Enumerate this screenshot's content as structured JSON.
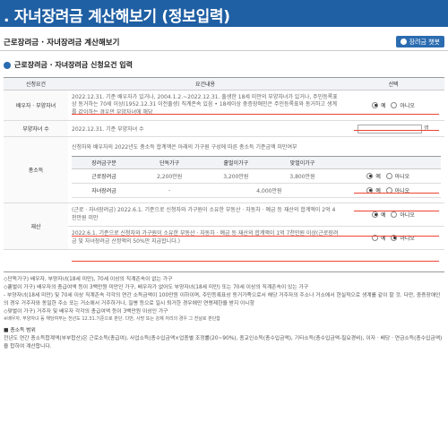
{
  "header": {
    "title": ". 자녀장려금 계산해보기 (정보입력)"
  },
  "subbar": {
    "breadcrumb": "근로장려금 · 자녀장려금 계산해보기",
    "help_label": "장려금 챗봇"
  },
  "section": {
    "title": "근로장려금 · 자녀장려금 신청요건 입력"
  },
  "table": {
    "headers": [
      "신청요건",
      "요건내용",
      "선택"
    ],
    "rows": {
      "spouse": {
        "label": "배우자 · 부양자녀",
        "text": "2022.12.31. 기준 배우자가 있거나, 2004.1.2.~2022.12.31. 출생한 18세 미만의 부양자녀가 있거나, 주민등록표상 동거하는 70세 이상(1952.12.31 이전출생) 직계존속 있음 • 18세이상 중증장애인은 주민등록표와 동거하고 생계를 같이하는 경우만 부양자녀에 해당",
        "yes": "예",
        "no": "아니오"
      },
      "children": {
        "label": "부양자녀 수",
        "text": "2022.12.31. 기준 부양자녀 수",
        "unit": "명"
      },
      "income": {
        "label": "총소득",
        "text": "신청자와 배우자의 2022년도 총소득 합계액은 아래의 가구원 구성에 따른 총소득 기준금액 미만여부",
        "inner_headers": [
          "장려금구분",
          "단독가구",
          "홑벌이가구",
          "맞벌이가구",
          ""
        ],
        "inner_rows": [
          {
            "name": "근로장려금",
            "single": "2,200만원",
            "one": "3,200만원",
            "dual": "3,800만원",
            "yes": "예",
            "no": "아니오"
          },
          {
            "name": "자녀장려금",
            "single": "-",
            "merged": "4,000만원",
            "yes": "예",
            "no": "아니오"
          }
        ]
      },
      "assets": {
        "label": "재산",
        "text1": "(근로 · 자녀장려금) 2022.6.1. 기준으로 신청자와 가구원이 소유한 부동산 · 자동차 · 예금 등 재산의 합계액이 2억 4천만원 미만",
        "text2": "2022.6.1. 기준으로 신청자와 가구원이 소유한 부동산 · 자동차 · 예금 등 재산의 합계액이 1억 7천만원 이상(근로장려금 및 자녀장려금 산정액의 50%만 지급합니다.)",
        "yes": "예",
        "no": "아니오"
      }
    }
  },
  "notes": {
    "lines": [
      "◇단독가구) 배우자, 부양자녀(18세 미만), 70세 이상의 직계존속이 없는 가구",
      "◇홑벌이 가구) 배우자의 총급여액 등이 3백만원 미만인 가구, 배우자가 없어도 부양자녀(18세 미만) 또는 70세 이상의 직계존속이 있는 가구",
      " - 부양자녀(18세 미만) 및 70세 이상 직계존속 각각의 연간 소득금액이 100만원 이하이며, 주민등록표상 동거가족으로서 해당 거주자의 주소나 거소에서 현실적으로 생계를 같이 할 것. 다만, 중증장애인의 경우 거주자와 동일한 주소 또는 거소에서 거주하거나, 질병 등으로 일시 퇴거한 경우에만 연령제한을 받지 아니함",
      "◇맞벌이 가구) 거주자 및 배우자 각각의 총급여액 등이 3백만원 이상인 가구"
    ],
    "small": "※배우자, 부양자녀 등 해당여부는 전년도 12.31.기준으로 판단. 다만, 사망 또는 강제 처리의 경우 그 전날로 판단함",
    "range_head": "■ 총소득 범위",
    "range_text": "전년도 연간 총소득합계액(부부합산)은 근로소득(총급여), 사업소득(총수입금액×업종별 조정률(20~90%), 종교인소득(총수입금액), 기타소득(총수입금액-필요경비), 이자 · 배당 · 연금소득(총수입금액)을 합하여 계산합니다."
  }
}
